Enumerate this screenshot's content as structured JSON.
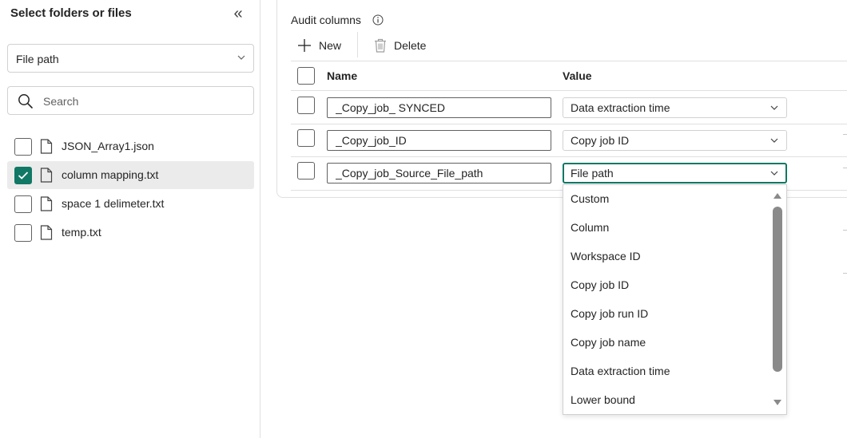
{
  "left_pane": {
    "title": "Select folders or files",
    "collapse_glyph": "«",
    "source_dropdown": {
      "value": "File path"
    },
    "search": {
      "placeholder": "Search"
    },
    "files": [
      {
        "name": "JSON_Array1.json",
        "checked": false
      },
      {
        "name": "column mapping.txt",
        "checked": true
      },
      {
        "name": "space 1 delimeter.txt",
        "checked": false
      },
      {
        "name": "temp.txt",
        "checked": false
      }
    ]
  },
  "audit": {
    "title": "Audit columns",
    "toolbar": {
      "new_label": "New",
      "delete_label": "Delete"
    },
    "headers": {
      "name": "Name",
      "value": "Value"
    },
    "rows": [
      {
        "name": "_Copy_job_ SYNCED",
        "value": "Data extraction time"
      },
      {
        "name": "_Copy_job_ID",
        "value": "Copy job ID"
      },
      {
        "name": "_Copy_job_Source_File_path",
        "value": "File path"
      }
    ],
    "value_options": [
      "Custom",
      "Column",
      "Workspace ID",
      "Copy job ID",
      "Copy job run ID",
      "Copy job name",
      "Data extraction time",
      "Lower bound"
    ]
  },
  "colors": {
    "accent": "#117865",
    "border": "#d1d1d1",
    "selected_row": "#ebebeb"
  },
  "icons": [
    "chevron-double-left-icon",
    "chevron-down-icon",
    "search-icon",
    "document-icon",
    "checkmark-icon",
    "info-icon",
    "add-icon",
    "delete-icon",
    "scroll-up-icon",
    "scroll-down-icon"
  ]
}
